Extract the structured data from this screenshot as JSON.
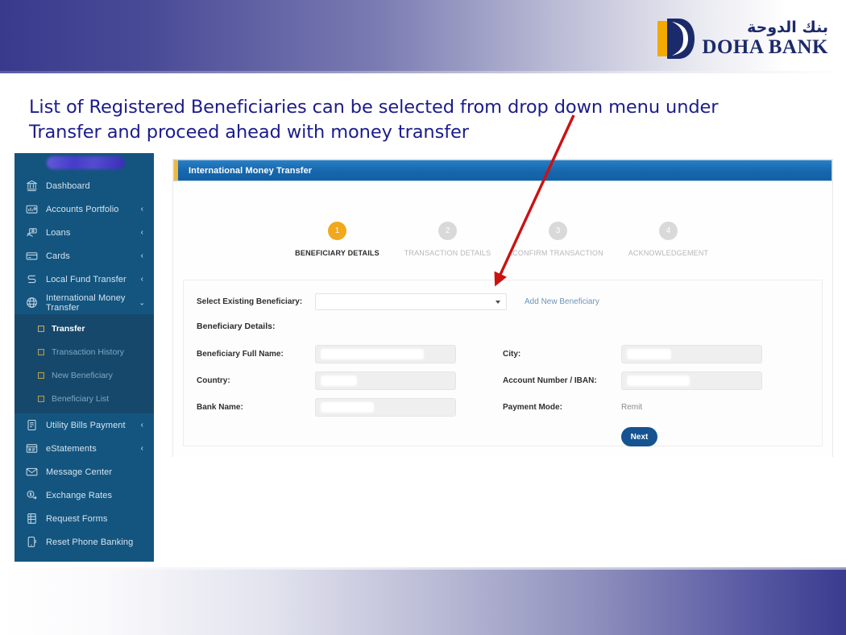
{
  "brand": {
    "logo_arabic": "بنك الدوحة",
    "logo_english": "DOHA BANK",
    "accent_yellow": "#f2a900",
    "navy": "#1b2a6b"
  },
  "annotation": {
    "heading": "List of Registered Beneficiaries can be selected from drop down menu under Transfer and proceed ahead with money transfer",
    "arrow_color": "#cc1111"
  },
  "sidebar": {
    "redacted_top_item": "",
    "items": [
      {
        "label": "Dashboard",
        "icon": "bank-icon",
        "caret": ""
      },
      {
        "label": "Accounts Portfolio",
        "icon": "accounts-icon",
        "caret": "‹"
      },
      {
        "label": "Loans",
        "icon": "loans-icon",
        "caret": "‹"
      },
      {
        "label": "Cards",
        "icon": "card-icon",
        "caret": "‹"
      },
      {
        "label": "Local Fund Transfer",
        "icon": "transfer-icon",
        "caret": "‹"
      },
      {
        "label": "International Money Transfer",
        "icon": "globe-icon",
        "caret": "⌄"
      }
    ],
    "submenu": [
      {
        "label": "Transfer",
        "active": true
      },
      {
        "label": "Transaction History",
        "active": false
      },
      {
        "label": "New Beneficiary",
        "active": false
      },
      {
        "label": "Beneficiary List",
        "active": false
      }
    ],
    "items_after": [
      {
        "label": "Utility Bills Payment",
        "icon": "bill-icon",
        "caret": "‹"
      },
      {
        "label": "eStatements",
        "icon": "statement-icon",
        "caret": "‹"
      },
      {
        "label": "Message Center",
        "icon": "mail-icon",
        "caret": ""
      },
      {
        "label": "Exchange Rates",
        "icon": "exchange-icon",
        "caret": ""
      },
      {
        "label": "Request Forms",
        "icon": "form-icon",
        "caret": ""
      },
      {
        "label": "Reset Phone Banking",
        "icon": "phone-icon",
        "caret": ""
      }
    ]
  },
  "panel": {
    "title": "International Money Transfer",
    "steps": [
      {
        "number": "1",
        "label": "BENEFICIARY DETAILS",
        "active": true
      },
      {
        "number": "2",
        "label": "TRANSACTION DETAILS",
        "active": false
      },
      {
        "number": "3",
        "label": "CONFIRM TRANSACTION",
        "active": false
      },
      {
        "number": "4",
        "label": "ACKNOWLEDGEMENT",
        "active": false
      }
    ],
    "form": {
      "select_label": "Select Existing Beneficiary:",
      "select_value": "",
      "select_placeholder": "",
      "add_new_link": "Add New Beneficiary",
      "details_title": "Beneficiary Details:",
      "fields_left": [
        {
          "label": "Beneficiary Full Name:",
          "value": "",
          "redacted": true
        },
        {
          "label": "Country:",
          "value": "",
          "redacted": true
        },
        {
          "label": "Bank Name:",
          "value": "",
          "redacted": true
        }
      ],
      "fields_right": [
        {
          "label": "City:",
          "value": "",
          "redacted": true,
          "type": "box"
        },
        {
          "label": "Account Number / IBAN:",
          "value": "",
          "redacted": true,
          "type": "box"
        },
        {
          "label": "Payment Mode:",
          "value": "Remit",
          "redacted": false,
          "type": "text"
        }
      ],
      "next_button": "Next"
    }
  }
}
